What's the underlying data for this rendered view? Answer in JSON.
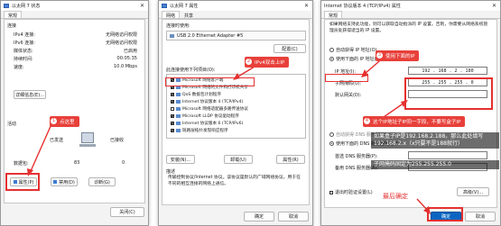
{
  "status_window": {
    "title": "以太网 7 状态",
    "tab": "常规",
    "section_connection": "连接",
    "rows": [
      {
        "label": "IPv4 连接:",
        "value": "无网络访问权限"
      },
      {
        "label": "IPv6 连接:",
        "value": "无网络访问权限"
      },
      {
        "label": "媒体状态:",
        "value": "已启用"
      },
      {
        "label": "持续时间:",
        "value": "00:05:35"
      },
      {
        "label": "速度:",
        "value": "10.0 Mbps"
      }
    ],
    "details_button": "详细信息(E)...",
    "section_activity": "活动",
    "sent_label": "已发送",
    "received_label": "已接收",
    "bytes_label": "数据包:",
    "bytes_sent": "83",
    "bytes_received": "0",
    "properties_button": "属性(P)",
    "disable_button": "禁用(D)",
    "diagnose_button": "诊断(G)",
    "close_button": "关闭(C)"
  },
  "props_window": {
    "title": "以太网 7 属性",
    "tabs": [
      "网络",
      "共享"
    ],
    "connect_using_label": "连接时使用:",
    "adapter_name": "USB 2.0 Ethernet Adapter #5",
    "configure_button": "配置(C)",
    "items_label": "此连接使用下列项目(O):",
    "items": [
      "Microsoft 网络客户端",
      "Microsoft 网络的文件和打印机共享",
      "QoS 数据包计划程序",
      "Internet 协议版本 4 (TCP/IPv4)",
      "Microsoft 网络适配器多路传送协议",
      "Microsoft LLDP 协议驱动程序",
      "Internet 协议版本 6 (TCP/IPv6)",
      "链路层拓扑发现响应程序"
    ],
    "install_button": "安装(N)...",
    "uninstall_button": "卸载(U)",
    "properties_button": "属性(R)",
    "description_label": "描述",
    "description_text": "传输控制协议/Internet 协议。该协议是默认的广域网络协议，用于在不同的相互连接的网络上通信。",
    "ok_button": "确定",
    "cancel_button": "取消"
  },
  "ipv4_window": {
    "title": "Internet 协议版本 4 (TCP/IPv4) 属性",
    "tab": "常规",
    "intro": "如果网络支持此功能，则可以获取自动指派的 IP 设置。否则，你需要从网络系统管理员处获得适当的 IP 设置。",
    "auto_ip": "自动获得 IP 地址(O)",
    "manual_ip": "使用下面的 IP 地址(S):",
    "ip_label": "IP 地址(I):",
    "ip_value": "192 . 168 . 2 . 180",
    "mask_label": "子网掩码(U):",
    "mask_value": "255 . 255 . 255 . 0",
    "gateway_label": "默认网关(D):",
    "auto_dns": "自动获得 DNS 服务器地址(B)",
    "manual_dns": "使用下面的 DNS 服务器地址(E):",
    "dns1_label": "首选 DNS 服务器(P):",
    "dns2_label": "备用 DNS 服务器(A):",
    "validate_label": "退出时验证设置(L)",
    "advanced_button": "高级(V)...",
    "ok_button": "确定",
    "cancel_button": "取消"
  },
  "annotations": {
    "c1_num": "1",
    "c1": "点这里",
    "c2_num": "2",
    "c2": "IPv4双击上IP",
    "c3_num": "3",
    "c3": "使用下面的IP",
    "c4_num": "4",
    "c4": "这个IP地址子IP同一字段，不要写盒子IP",
    "note": "如果盒子IP是192.168.2.188，那么此处填写192.168.2.x（x只要不是188就行）",
    "note2": "子网掩码固定为255.255.255.0",
    "final": "最后确定"
  }
}
